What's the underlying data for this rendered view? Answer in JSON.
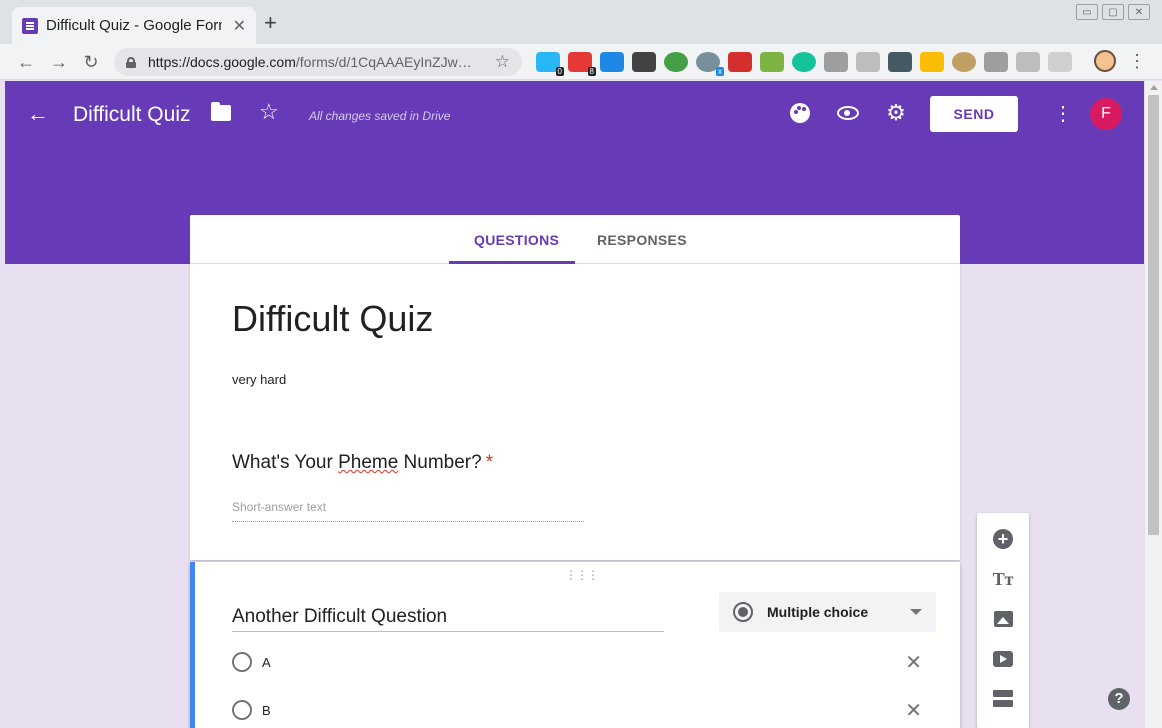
{
  "browser": {
    "tab_title": "Difficult Quiz - Google Forms",
    "tab_close": "✕",
    "new_tab": "+",
    "url_host": "https://docs.google.com",
    "url_path": "/forms/d/1CqAAAEyInZJw…",
    "extension_badges": {
      "ext1": "0",
      "ext2": "8",
      "ext6": "x"
    },
    "window_controls": [
      "▭",
      "▢",
      "✕"
    ]
  },
  "header": {
    "title": "Difficult Quiz",
    "saved_status": "All changes saved in Drive",
    "send_label": "SEND",
    "avatar_initial": "F",
    "accent_color": "#673ab7"
  },
  "tabs": {
    "questions": "QUESTIONS",
    "responses": "RESPONSES"
  },
  "form": {
    "title": "Difficult Quiz",
    "description": "very hard",
    "q1": {
      "title_before": "What's Your ",
      "title_misspelled": "Pheme",
      "title_after": " Number?",
      "required_mark": "*",
      "answer_placeholder": "Short-answer text"
    },
    "q2": {
      "title": "Another Difficult Question",
      "type": "Multiple choice",
      "options": [
        "A",
        "B"
      ]
    }
  },
  "side_tools": [
    "add-question",
    "add-title-and-description",
    "add-image",
    "add-video",
    "add-section"
  ],
  "help": "?"
}
